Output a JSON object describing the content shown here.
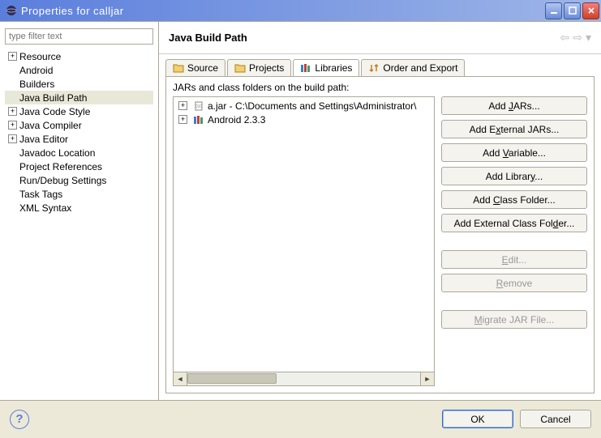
{
  "window": {
    "title": "Properties for calljar"
  },
  "filter": {
    "placeholder": "type filter text"
  },
  "tree": [
    {
      "label": "Resource",
      "expandable": true,
      "expanded": false
    },
    {
      "label": "Android",
      "expandable": false
    },
    {
      "label": "Builders",
      "expandable": false
    },
    {
      "label": "Java Build Path",
      "expandable": false,
      "selected": true
    },
    {
      "label": "Java Code Style",
      "expandable": true,
      "expanded": false
    },
    {
      "label": "Java Compiler",
      "expandable": true,
      "expanded": false
    },
    {
      "label": "Java Editor",
      "expandable": true,
      "expanded": false
    },
    {
      "label": "Javadoc Location",
      "expandable": false
    },
    {
      "label": "Project References",
      "expandable": false
    },
    {
      "label": "Run/Debug Settings",
      "expandable": false
    },
    {
      "label": "Task Tags",
      "expandable": false
    },
    {
      "label": "XML Syntax",
      "expandable": false
    }
  ],
  "page": {
    "title": "Java Build Path"
  },
  "tabs": [
    {
      "label": "Source",
      "icon": "folder"
    },
    {
      "label": "Projects",
      "icon": "folder"
    },
    {
      "label": "Libraries",
      "icon": "library",
      "active": true
    },
    {
      "label": "Order and Export",
      "icon": "order"
    }
  ],
  "libtab": {
    "desc": "JARs and class folders on the build path:",
    "entries": [
      {
        "icon": "jar",
        "label": "a.jar - C:\\Documents and Settings\\Administrator\\"
      },
      {
        "icon": "lib",
        "label": "Android 2.3.3"
      }
    ],
    "buttons": [
      {
        "key": "add_jars",
        "html": "Add <u>J</u>ARs...",
        "enabled": true
      },
      {
        "key": "add_ext_jars",
        "html": "Add E<u>x</u>ternal JARs...",
        "enabled": true
      },
      {
        "key": "add_var",
        "html": "Add <u>V</u>ariable...",
        "enabled": true
      },
      {
        "key": "add_lib",
        "html": "Add Librar<u>y</u>...",
        "enabled": true
      },
      {
        "key": "add_cls",
        "html": "Add <u>C</u>lass Folder...",
        "enabled": true
      },
      {
        "key": "add_ext_cls",
        "html": "Add External Class Fol<u>d</u>er...",
        "enabled": true
      },
      {
        "gap": true
      },
      {
        "key": "edit",
        "html": "<u>E</u>dit...",
        "enabled": false
      },
      {
        "key": "remove",
        "html": "<u>R</u>emove",
        "enabled": false
      },
      {
        "gap": true
      },
      {
        "key": "migrate",
        "html": "<u>M</u>igrate JAR File...",
        "enabled": false
      }
    ]
  },
  "bottom": {
    "ok": "OK",
    "cancel": "Cancel"
  }
}
